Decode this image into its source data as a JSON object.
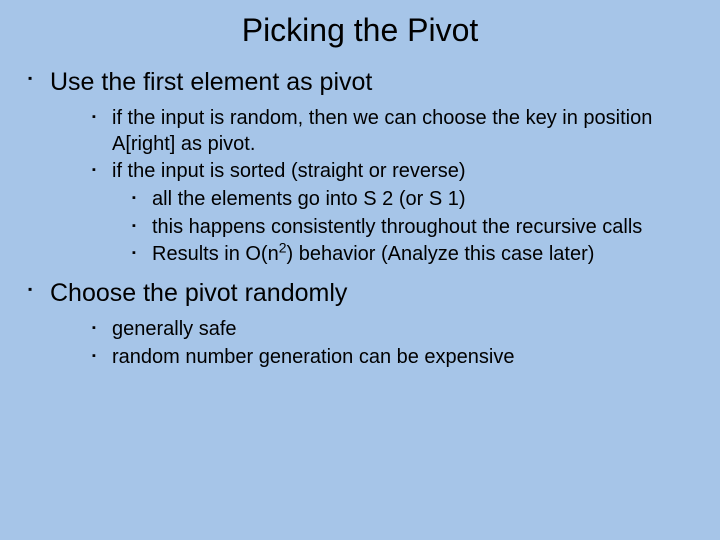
{
  "title": "Picking the Pivot",
  "points": {
    "p1": {
      "label": "Use the first element as pivot",
      "sub": {
        "s1": "if the input is random, then we can choose the key in position A[right] as pivot.",
        "s2": "if the input is sorted (straight or reverse)",
        "s2sub": {
          "a": "all the elements go into S 2 (or S 1)",
          "b": "this happens consistently throughout the recursive calls",
          "c_pre": "Results in O(n",
          "c_sup": "2",
          "c_post": ") behavior (Analyze this case later)"
        }
      }
    },
    "p2": {
      "label": "Choose the pivot randomly",
      "sub": {
        "s1": "generally safe",
        "s2": "random number generation can be expensive"
      }
    }
  }
}
